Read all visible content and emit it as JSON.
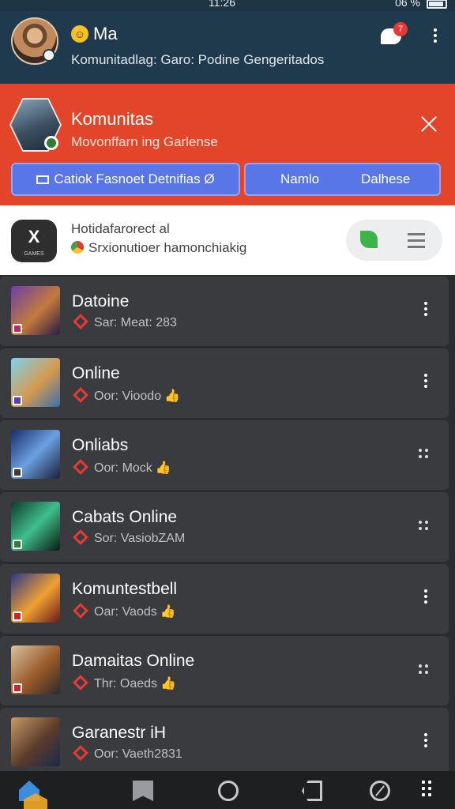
{
  "status_bar": {
    "time": "11:26",
    "signal": "06 %"
  },
  "header": {
    "name": "Ma",
    "emoji": "☺",
    "subtitle": "Komunitadlag: Garo: Podine Gengeritados",
    "notification_count": "7"
  },
  "banner": {
    "title": "Komunitas",
    "subtitle": "Movonffarn ing Garlense",
    "left_button": "Catiok Fasnoet Detnifias Ø",
    "right_button_a": "Namlo",
    "right_button_b": "Dalhese",
    "accent_color": "#e2452a",
    "button_color": "#5876e8"
  },
  "notice": {
    "logo_text": "X",
    "logo_small": "GAMES",
    "line1": "Hotidafarorect al",
    "line2": "Srxionutioer hamonchiakig"
  },
  "games": [
    {
      "title": "Datoine",
      "meta": "Sar: Meat: 283",
      "like": "",
      "action": "more"
    },
    {
      "title": "Online",
      "meta": "Oor: Vioodo",
      "like": "👍",
      "action": "more"
    },
    {
      "title": "Onliabs",
      "meta": "Oor: Mock",
      "like": "👍",
      "action": "grid"
    },
    {
      "title": "Cabats Online",
      "meta": "Sor: VasiobZAM",
      "like": "",
      "action": "grid"
    },
    {
      "title": "Komuntestbell",
      "meta": "Oar: Vaods",
      "like": "👍",
      "action": "more"
    },
    {
      "title": "Damaitas Online",
      "meta": "Thr: Oaeds",
      "like": "👍",
      "action": "grid"
    },
    {
      "title": "Garanestr iH",
      "meta": "Oor: Vaeth2831",
      "like": "",
      "action": "more"
    }
  ],
  "bottom_nav": {
    "items": [
      "home-icon",
      "bookmark-icon",
      "circle-icon",
      "back-icon",
      "compass-icon",
      "grid-icon"
    ]
  }
}
